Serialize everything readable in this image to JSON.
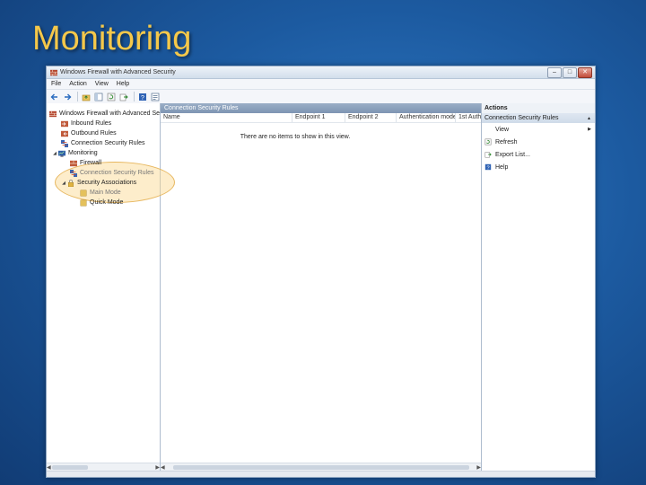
{
  "slide": {
    "title": "Monitoring",
    "title_color": "#f5c84a"
  },
  "window": {
    "title": "Windows Firewall with Advanced Security",
    "controls": {
      "minimize": "–",
      "maximize": "□",
      "close": "✕"
    }
  },
  "menu": [
    "File",
    "Action",
    "View",
    "Help"
  ],
  "toolbar": [
    "back-arrow-icon",
    "forward-arrow-icon",
    "folder-up-icon",
    "show-hide-tree-icon",
    "refresh-icon",
    "export-icon",
    "help-icon",
    "properties-icon"
  ],
  "tree": {
    "root": "Windows Firewall with Advanced Se",
    "items": [
      {
        "label": "Inbound Rules",
        "level": 1,
        "icon": "inbound-rules-icon"
      },
      {
        "label": "Outbound Rules",
        "level": 1,
        "icon": "outbound-rules-icon"
      },
      {
        "label": "Connection Security Rules",
        "level": 1,
        "icon": "connection-security-icon"
      },
      {
        "label": "Monitoring",
        "level": 1,
        "icon": "monitoring-icon",
        "expanded": true
      },
      {
        "label": "Firewall",
        "level": 2,
        "icon": "firewall-icon"
      },
      {
        "label": "Connection Security Rules",
        "level": 2,
        "icon": "connection-security-icon"
      },
      {
        "label": "Security Associations",
        "level": 2,
        "icon": "security-associations-icon",
        "expanded": true
      },
      {
        "label": "Main Mode",
        "level": 3,
        "icon": "main-mode-icon"
      },
      {
        "label": "Quick Mode",
        "level": 3,
        "icon": "quick-mode-icon"
      }
    ]
  },
  "center": {
    "header": "Connection Security Rules",
    "columns": [
      "Name",
      "Endpoint 1",
      "Endpoint 2",
      "Authentication mode",
      "1st Auth"
    ],
    "empty_message": "There are no items to show in this view."
  },
  "actions": {
    "header": "Actions",
    "group": "Connection Security Rules",
    "items": [
      {
        "label": "View",
        "icon": "",
        "submenu": true
      },
      {
        "label": "Refresh",
        "icon": "refresh-icon"
      },
      {
        "label": "Export List...",
        "icon": "export-list-icon"
      },
      {
        "label": "Help",
        "icon": "help-icon"
      }
    ]
  },
  "colors": {
    "pane_header": "#8aa0bc",
    "highlight": "#fad68c"
  }
}
